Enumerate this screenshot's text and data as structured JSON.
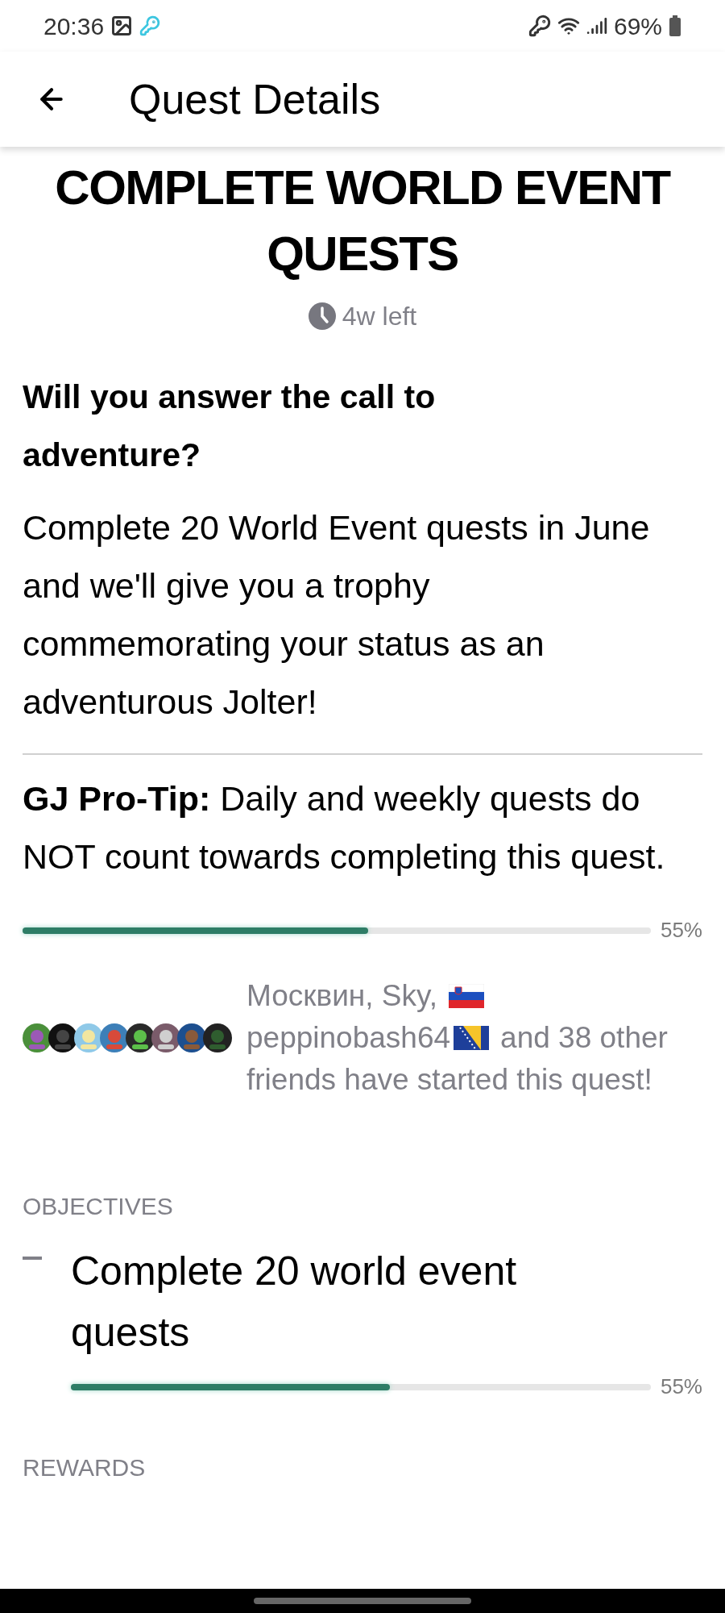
{
  "status_bar": {
    "time": "20:36",
    "battery": "69%"
  },
  "header": {
    "title": "Quest Details"
  },
  "quest": {
    "title_lines": [
      "COMPLETE WORLD EVENT",
      "QUESTS"
    ],
    "time_left": "4w left",
    "question": "Will you answer the call to adventure?",
    "description": "Complete 20 World Event quests in June and we'll give you a trophy commemorating your status as an adventurous Jolter!",
    "tip": "**GJ Pro-Tip:** Daily and weekly quests do NOT count towards completing this quest.",
    "progress": {
      "level": 0.55,
      "reading": "55%"
    },
    "friends": {
      "segments": [
        "Москвин, Sky,",
        "peppinobash64",
        "and 38 other",
        "friends have started this quest!"
      ]
    }
  },
  "objectives": {
    "heading": "OBJECTIVES",
    "items": [
      {
        "text": "Complete 20 world event quests",
        "done": false,
        "level": 0.55,
        "reading": "55%"
      }
    ]
  },
  "rewards": {
    "heading": "REWARDS"
  }
}
